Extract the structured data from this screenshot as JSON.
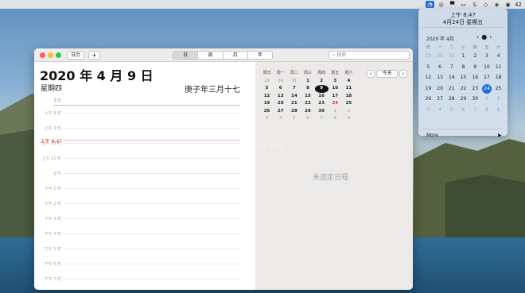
{
  "menubar": {
    "icons": [
      "notification-center-icon",
      "wechat-icon",
      "display-icon",
      "screen-icon",
      "s-icon",
      "cube-icon",
      "box-icon",
      "cat-icon"
    ],
    "temperature": "42"
  },
  "widget": {
    "time": "上午 8:47",
    "date": "4月24日 星期五",
    "month_title": "2020 年 4月",
    "headers": [
      "日",
      "一",
      "二",
      "三",
      "四",
      "五",
      "六"
    ],
    "weeks": [
      [
        {
          "d": "29",
          "o": true
        },
        {
          "d": "30",
          "o": true
        },
        {
          "d": "31",
          "o": true
        },
        {
          "d": "1"
        },
        {
          "d": "2"
        },
        {
          "d": "3"
        },
        {
          "d": "4"
        }
      ],
      [
        {
          "d": "5"
        },
        {
          "d": "6"
        },
        {
          "d": "7"
        },
        {
          "d": "8"
        },
        {
          "d": "9"
        },
        {
          "d": "10"
        },
        {
          "d": "11"
        }
      ],
      [
        {
          "d": "12"
        },
        {
          "d": "13"
        },
        {
          "d": "14"
        },
        {
          "d": "15"
        },
        {
          "d": "16"
        },
        {
          "d": "17"
        },
        {
          "d": "18"
        }
      ],
      [
        {
          "d": "19"
        },
        {
          "d": "20"
        },
        {
          "d": "21"
        },
        {
          "d": "22"
        },
        {
          "d": "23"
        },
        {
          "d": "24",
          "t": true
        },
        {
          "d": "25"
        }
      ],
      [
        {
          "d": "26"
        },
        {
          "d": "27"
        },
        {
          "d": "28"
        },
        {
          "d": "29"
        },
        {
          "d": "30"
        },
        {
          "d": "1",
          "o": true
        },
        {
          "d": "2",
          "o": true
        }
      ],
      [
        {
          "d": "3",
          "o": true
        },
        {
          "d": "4",
          "o": true
        },
        {
          "d": "5",
          "o": true
        },
        {
          "d": "6",
          "o": true
        },
        {
          "d": "7",
          "o": true
        },
        {
          "d": "8",
          "o": true
        },
        {
          "d": "9",
          "o": true
        }
      ]
    ],
    "more_label": "More"
  },
  "window": {
    "toolbar": {
      "calendars_label": "日历",
      "add_label": "+",
      "views": [
        "日",
        "周",
        "月",
        "年"
      ],
      "selected_view": "日",
      "search_placeholder": "搜索"
    },
    "day": {
      "title": "2020 年 4 月 9 日",
      "weekday": "星期四",
      "lunar": "庚子年三月十七",
      "allday_label": "全天",
      "now_label": "上午 8:47",
      "hours": [
        "上午 8 时",
        "上午 9 时",
        "上午 10 时",
        "上午 11 时",
        "正午",
        "下午 1 时",
        "下午 2 时",
        "下午 3 时",
        "下午 4 时",
        "下午 5 时",
        "下午 6 时",
        "下午 7 时"
      ]
    },
    "mini": {
      "headers": [
        "周日",
        "周一",
        "周二",
        "周三",
        "周四",
        "周五",
        "周六"
      ],
      "weeks": [
        [
          {
            "d": "29",
            "o": true
          },
          {
            "d": "30",
            "o": true
          },
          {
            "d": "31",
            "o": true
          },
          {
            "d": "1"
          },
          {
            "d": "2"
          },
          {
            "d": "3"
          },
          {
            "d": "4"
          }
        ],
        [
          {
            "d": "5"
          },
          {
            "d": "6"
          },
          {
            "d": "7"
          },
          {
            "d": "8"
          },
          {
            "d": "9",
            "s": true
          },
          {
            "d": "10"
          },
          {
            "d": "11"
          }
        ],
        [
          {
            "d": "12"
          },
          {
            "d": "13"
          },
          {
            "d": "14"
          },
          {
            "d": "15"
          },
          {
            "d": "16"
          },
          {
            "d": "17"
          },
          {
            "d": "18"
          }
        ],
        [
          {
            "d": "19"
          },
          {
            "d": "20"
          },
          {
            "d": "21"
          },
          {
            "d": "22"
          },
          {
            "d": "23"
          },
          {
            "d": "24",
            "t": true
          },
          {
            "d": "25"
          }
        ],
        [
          {
            "d": "26"
          },
          {
            "d": "27"
          },
          {
            "d": "28"
          },
          {
            "d": "29"
          },
          {
            "d": "30"
          },
          {
            "d": "1",
            "o": true
          },
          {
            "d": "2",
            "o": true
          }
        ],
        [
          {
            "d": "3",
            "o": true
          },
          {
            "d": "4",
            "o": true
          },
          {
            "d": "5",
            "o": true
          },
          {
            "d": "6",
            "o": true
          },
          {
            "d": "7",
            "o": true
          },
          {
            "d": "8",
            "o": true
          },
          {
            "d": "9",
            "o": true
          }
        ]
      ],
      "today_button": "今天"
    },
    "no_event": "未选定日程"
  },
  "watermark": "www.MacW.com",
  "colors": {
    "accent": "#1f6fd8",
    "now_red": "#e0302a"
  }
}
